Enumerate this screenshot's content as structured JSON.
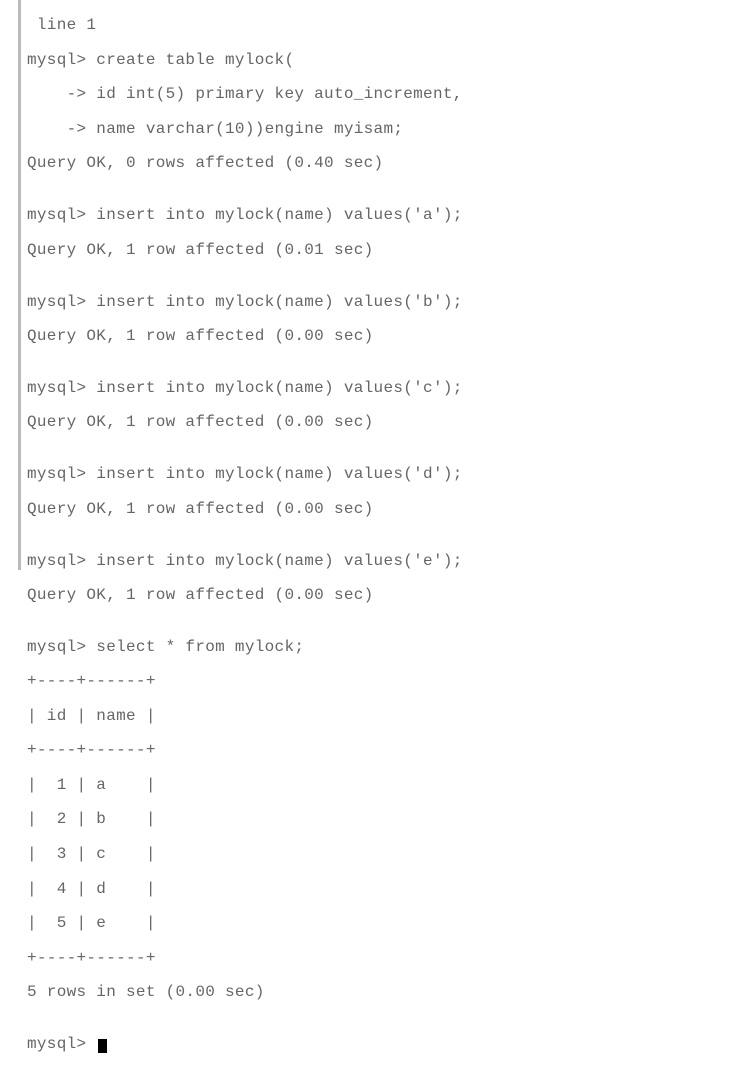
{
  "terminal": {
    "lines": [
      " line 1",
      "mysql> create table mylock(",
      "    -> id int(5) primary key auto_increment,",
      "    -> name varchar(10))engine myisam;",
      "Query OK, 0 rows affected (0.40 sec)",
      "",
      "mysql> insert into mylock(name) values('a');",
      "Query OK, 1 row affected (0.01 sec)",
      "",
      "mysql> insert into mylock(name) values('b');",
      "Query OK, 1 row affected (0.00 sec)",
      "",
      "mysql> insert into mylock(name) values('c');",
      "Query OK, 1 row affected (0.00 sec)",
      "",
      "mysql> insert into mylock(name) values('d');",
      "Query OK, 1 row affected (0.00 sec)",
      "",
      "mysql> insert into mylock(name) values('e');",
      "Query OK, 1 row affected (0.00 sec)",
      "",
      "mysql> select * from mylock;",
      "+----+------+",
      "| id | name |",
      "+----+------+",
      "|  1 | a    |",
      "|  2 | b    |",
      "|  3 | c    |",
      "|  4 | d    |",
      "|  5 | e    |",
      "+----+------+",
      "5 rows in set (0.00 sec)",
      ""
    ],
    "prompt": "mysql> "
  }
}
